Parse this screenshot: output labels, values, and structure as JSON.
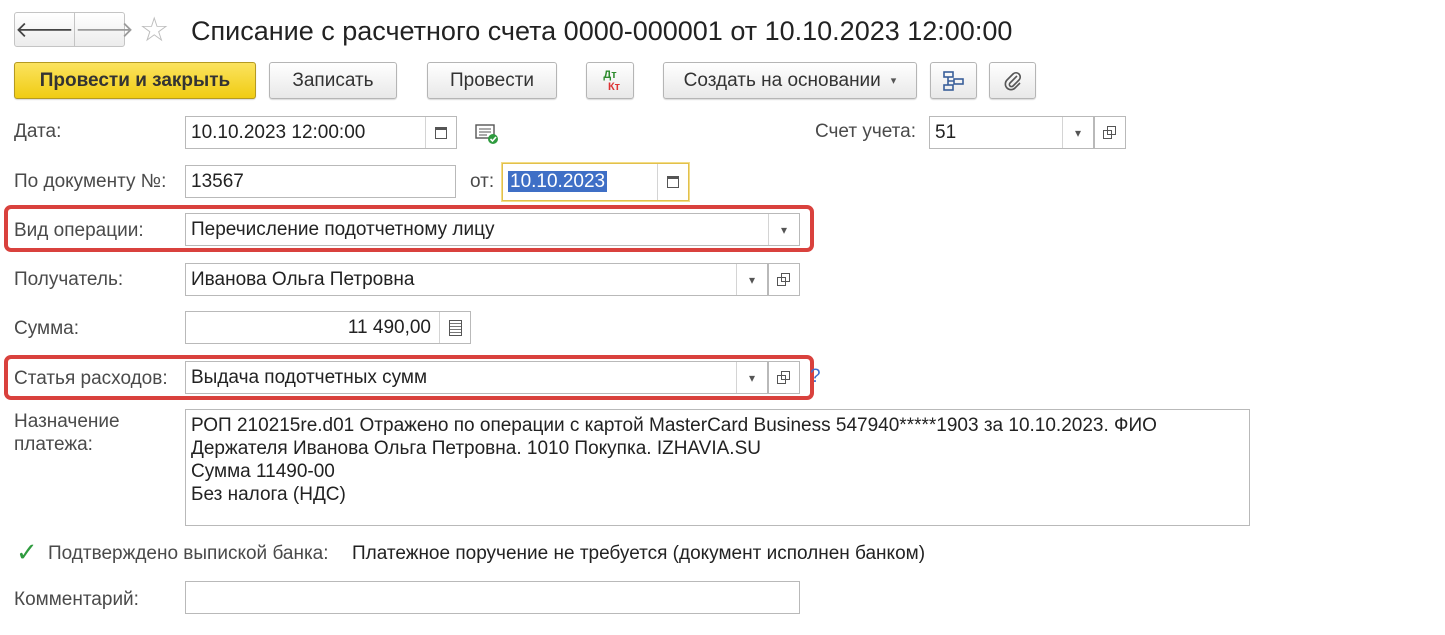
{
  "window": {
    "title": "Списание с расчетного счета 0000-000001 от 10.10.2023 12:00:00",
    "back_arrow": "🡐",
    "forward_arrow": "🡒",
    "favorite_star": "☆"
  },
  "toolbar": {
    "post_and_close": "Провести и закрыть",
    "save": "Записать",
    "post": "Провести",
    "dtkt_top": "Дт",
    "dtkt_bottom": "Кт",
    "create_based_on": "Создать на основании",
    "create_based_on_caret": "▾"
  },
  "form": {
    "date": {
      "label": "Дата:",
      "value": "10.10.2023 12:00:00"
    },
    "account": {
      "label": "Счет учета:",
      "value": "51"
    },
    "doc_number": {
      "label": "По документу №:",
      "value": "13567"
    },
    "doc_date": {
      "label": "от:",
      "value": "10.10.2023"
    },
    "operation_type": {
      "label": "Вид операции:",
      "value": "Перечисление подотчетному лицу"
    },
    "recipient": {
      "label": "Получатель:",
      "value": "Иванова Ольга Петровна"
    },
    "amount": {
      "label": "Сумма:",
      "value": "11 490,00"
    },
    "expense_item": {
      "label": "Статья расходов:",
      "value": "Выдача подотчетных сумм",
      "help": "?"
    },
    "payment_purpose": {
      "label_line1": "Назначение",
      "label_line2": "платежа:",
      "lines": [
        "РОП 210215re.d01 Отражено по операции с картой MasterCard Business 547940*****1903 за 10.10.2023. ФИО",
        "Держателя Иванова Ольга Петровна. 1010 Покупка. IZHAVIA.SU",
        "Сумма 11490-00",
        "Без налога (НДС)"
      ]
    },
    "bank_confirmed": {
      "check_mark": "✓",
      "label": "Подтверждено выпиской банка:",
      "status_text": "Платежное поручение не требуется (документ исполнен банком)"
    },
    "comment": {
      "label": "Комментарий:",
      "value": ""
    }
  },
  "dropdown_caret": "▾",
  "colors": {
    "primary_button": "#f0cc12",
    "highlight_frame": "#d9413d",
    "focus_border": "#e2c04c",
    "selection": "#3f6fc6",
    "check": "#2f9b3f"
  }
}
